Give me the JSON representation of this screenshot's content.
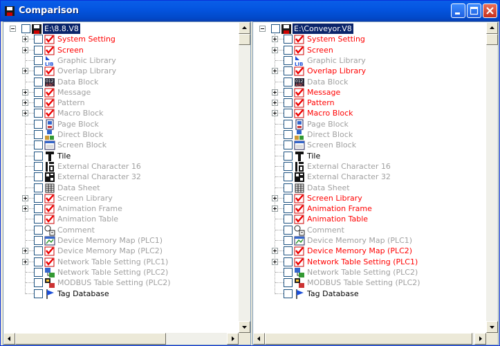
{
  "window": {
    "title": "Comparison"
  },
  "left": {
    "root": "E:\\8.8.V8",
    "items": [
      {
        "label": "System Setting",
        "color": "red",
        "expand": true,
        "icon": "check-red-icon"
      },
      {
        "label": "Screen",
        "color": "red",
        "expand": true,
        "icon": "check-red-icon"
      },
      {
        "label": "Graphic Library",
        "color": "gray",
        "expand": false,
        "icon": "lib-icon"
      },
      {
        "label": "Overlap Library",
        "color": "gray",
        "expand": true,
        "icon": "check-red-icon"
      },
      {
        "label": "Data Block",
        "color": "gray",
        "expand": false,
        "icon": "data-block-icon"
      },
      {
        "label": "Message",
        "color": "gray",
        "expand": true,
        "icon": "check-red-icon"
      },
      {
        "label": "Pattern",
        "color": "gray",
        "expand": true,
        "icon": "check-red-icon"
      },
      {
        "label": "Macro Block",
        "color": "gray",
        "expand": true,
        "icon": "check-red-icon"
      },
      {
        "label": "Page Block",
        "color": "gray",
        "expand": false,
        "icon": "page-block-icon"
      },
      {
        "label": "Direct Block",
        "color": "gray",
        "expand": false,
        "icon": "direct-block-icon"
      },
      {
        "label": "Screen Block",
        "color": "gray",
        "expand": false,
        "icon": "screen-block-icon"
      },
      {
        "label": "Tile",
        "color": "black",
        "expand": false,
        "icon": "tile-icon"
      },
      {
        "label": "External Character 16",
        "color": "gray",
        "expand": false,
        "icon": "char16-icon"
      },
      {
        "label": "External Character 32",
        "color": "gray",
        "expand": false,
        "icon": "char32-icon"
      },
      {
        "label": "Data Sheet",
        "color": "gray",
        "expand": false,
        "icon": "data-sheet-icon"
      },
      {
        "label": "Screen Library",
        "color": "gray",
        "expand": true,
        "icon": "check-red-icon"
      },
      {
        "label": "Animation Frame",
        "color": "gray",
        "expand": true,
        "icon": "check-red-icon"
      },
      {
        "label": "Animation Table",
        "color": "gray",
        "expand": false,
        "icon": "check-red-icon"
      },
      {
        "label": "Comment",
        "color": "gray",
        "expand": false,
        "icon": "comment-icon"
      },
      {
        "label": "Device Memory Map (PLC1)",
        "color": "gray",
        "expand": false,
        "icon": "memory-map-icon"
      },
      {
        "label": "Device Memory Map (PLC2)",
        "color": "gray",
        "expand": true,
        "icon": "check-red-icon"
      },
      {
        "label": "Network Table Setting (PLC1)",
        "color": "gray",
        "expand": true,
        "icon": "check-red-icon"
      },
      {
        "label": "Network Table Setting (PLC2)",
        "color": "gray",
        "expand": false,
        "icon": "network-icon"
      },
      {
        "label": "MODBUS Table Setting (PLC2)",
        "color": "gray",
        "expand": false,
        "icon": "modbus-icon"
      },
      {
        "label": "Tag Database",
        "color": "black",
        "expand": false,
        "icon": "tag-icon"
      }
    ]
  },
  "right": {
    "root": "E:\\Conveyor.V8",
    "items": [
      {
        "label": "System Setting",
        "color": "red",
        "expand": true,
        "icon": "check-red-icon"
      },
      {
        "label": "Screen",
        "color": "red",
        "expand": true,
        "icon": "check-red-icon"
      },
      {
        "label": "Graphic Library",
        "color": "gray",
        "expand": false,
        "icon": "lib-icon"
      },
      {
        "label": "Overlap Library",
        "color": "red",
        "expand": true,
        "icon": "check-red-icon"
      },
      {
        "label": "Data Block",
        "color": "gray",
        "expand": false,
        "icon": "data-block-icon"
      },
      {
        "label": "Message",
        "color": "red",
        "expand": true,
        "icon": "check-red-icon"
      },
      {
        "label": "Pattern",
        "color": "red",
        "expand": true,
        "icon": "check-red-icon"
      },
      {
        "label": "Macro Block",
        "color": "red",
        "expand": true,
        "icon": "check-red-icon"
      },
      {
        "label": "Page Block",
        "color": "gray",
        "expand": false,
        "icon": "page-block-icon"
      },
      {
        "label": "Direct Block",
        "color": "gray",
        "expand": false,
        "icon": "direct-block-icon"
      },
      {
        "label": "Screen Block",
        "color": "gray",
        "expand": false,
        "icon": "screen-block-icon"
      },
      {
        "label": "Tile",
        "color": "black",
        "expand": false,
        "icon": "tile-icon"
      },
      {
        "label": "External Character 16",
        "color": "gray",
        "expand": false,
        "icon": "char16-icon"
      },
      {
        "label": "External Character 32",
        "color": "gray",
        "expand": false,
        "icon": "char32-icon"
      },
      {
        "label": "Data Sheet",
        "color": "gray",
        "expand": false,
        "icon": "data-sheet-icon"
      },
      {
        "label": "Screen Library",
        "color": "red",
        "expand": true,
        "icon": "check-red-icon"
      },
      {
        "label": "Animation Frame",
        "color": "red",
        "expand": true,
        "icon": "check-red-icon"
      },
      {
        "label": "Animation Table",
        "color": "red",
        "expand": false,
        "icon": "check-red-icon"
      },
      {
        "label": "Comment",
        "color": "gray",
        "expand": false,
        "icon": "comment-icon"
      },
      {
        "label": "Device Memory Map (PLC1)",
        "color": "gray",
        "expand": false,
        "icon": "memory-map-icon"
      },
      {
        "label": "Device Memory Map (PLC2)",
        "color": "red",
        "expand": true,
        "icon": "check-red-icon"
      },
      {
        "label": "Network Table Setting (PLC1)",
        "color": "red",
        "expand": true,
        "icon": "check-red-icon"
      },
      {
        "label": "Network Table Setting (PLC2)",
        "color": "gray",
        "expand": false,
        "icon": "network-icon"
      },
      {
        "label": "MODBUS Table Setting (PLC2)",
        "color": "gray",
        "expand": false,
        "icon": "modbus-icon"
      },
      {
        "label": "Tag Database",
        "color": "black",
        "expand": false,
        "icon": "tag-icon"
      }
    ]
  }
}
